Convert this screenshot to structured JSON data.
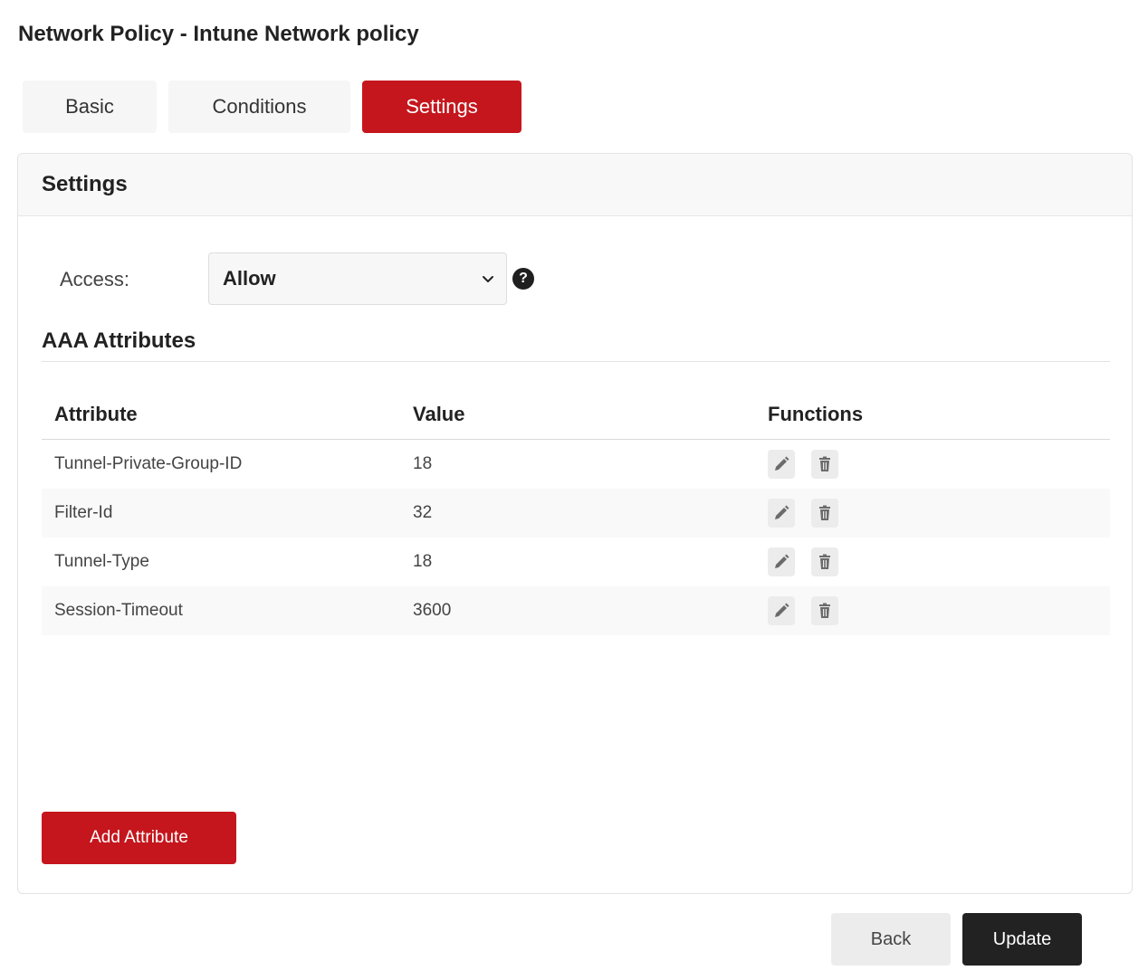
{
  "page": {
    "title": "Network Policy - Intune Network policy"
  },
  "tabs": [
    {
      "label": "Basic"
    },
    {
      "label": "Conditions"
    },
    {
      "label": "Settings",
      "active": true
    }
  ],
  "settings": {
    "title": "Settings",
    "access": {
      "label": "Access:",
      "value": "Allow"
    },
    "help_icon": "?"
  },
  "aaa": {
    "title": "AAA Attributes",
    "columns": [
      "Attribute",
      "Value",
      "Functions"
    ],
    "rows": [
      {
        "attribute": "Tunnel-Private-Group-ID",
        "value": "18"
      },
      {
        "attribute": "Filter-Id",
        "value": "32"
      },
      {
        "attribute": "Tunnel-Type",
        "value": "18"
      },
      {
        "attribute": "Session-Timeout",
        "value": "3600"
      }
    ]
  },
  "buttons": {
    "add_attribute": "Add Attribute",
    "back": "Back",
    "update": "Update"
  },
  "colors": {
    "accent": "#c5161d",
    "dark": "#222222"
  }
}
